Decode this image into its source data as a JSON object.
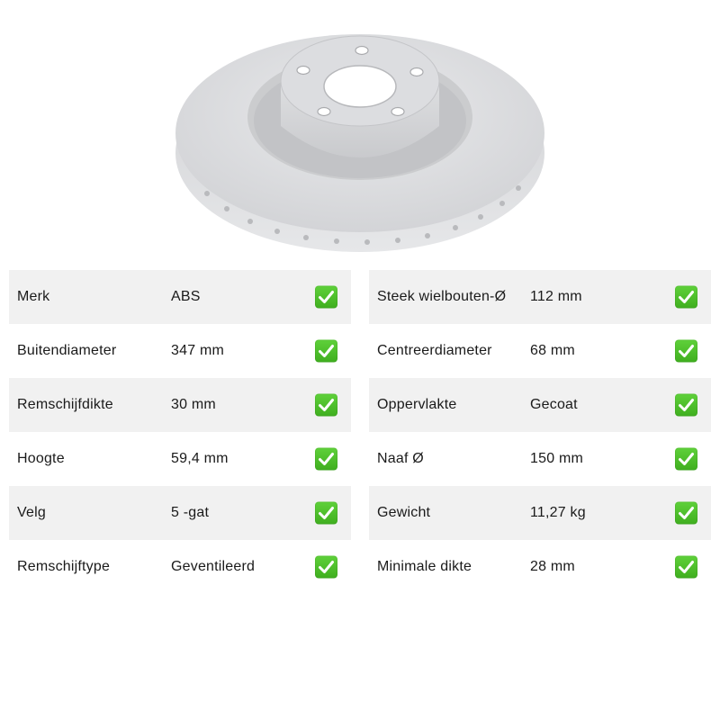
{
  "product_image": {
    "alt_icon": "brake-disc"
  },
  "left_specs": [
    {
      "label": "Merk",
      "value": "ABS"
    },
    {
      "label": "Buitendiameter",
      "value": "347 mm"
    },
    {
      "label": "Remschijfdikte",
      "value": "30 mm"
    },
    {
      "label": "Hoogte",
      "value": "59,4 mm"
    },
    {
      "label": "Velg",
      "value": "5 -gat"
    },
    {
      "label": "Remschijftype",
      "value": "Geventileerd"
    }
  ],
  "right_specs": [
    {
      "label": "Steek wielbouten-Ø",
      "value": "112 mm"
    },
    {
      "label": "Centreerdiameter",
      "value": "68 mm"
    },
    {
      "label": "Oppervlakte",
      "value": "Gecoat"
    },
    {
      "label": "Naaf Ø",
      "value": "150 mm"
    },
    {
      "label": "Gewicht",
      "value": "11,27 kg"
    },
    {
      "label": "Minimale dikte",
      "value": "28 mm"
    }
  ],
  "colors": {
    "row_shade": "#f1f1f1",
    "check_green": "#46b828",
    "disc_metal": "#d9dadc"
  }
}
